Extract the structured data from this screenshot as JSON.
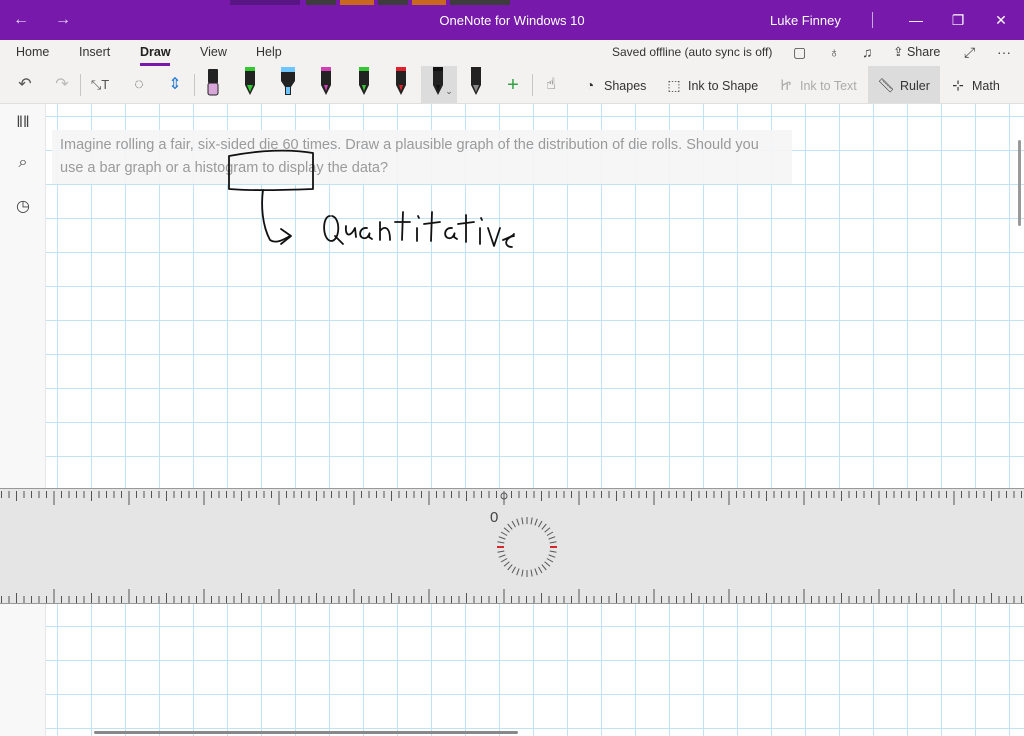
{
  "window": {
    "title": "OneNote for Windows 10",
    "user": "Luke Finney"
  },
  "menu": {
    "items": [
      "Home",
      "Insert",
      "Draw",
      "View",
      "Help"
    ],
    "active": "Draw",
    "sync_status": "Saved offline (auto sync is off)",
    "share_label": "Share"
  },
  "toolbar": {
    "shapes_label": "Shapes",
    "ink_to_shape_label": "Ink to Shape",
    "ink_to_text_label": "Ink to Text",
    "ruler_label": "Ruler",
    "math_label": "Math",
    "pens": [
      {
        "kind": "eraser",
        "color": "#d9a6d9"
      },
      {
        "kind": "pencil",
        "color": "#32c832"
      },
      {
        "kind": "highlighter",
        "color": "#6ec6ff"
      },
      {
        "kind": "pen",
        "color": "#d23fb4"
      },
      {
        "kind": "pen",
        "color": "#32c832"
      },
      {
        "kind": "pen",
        "color": "#e0202a"
      },
      {
        "kind": "pen",
        "color": "#111111",
        "selected": true
      },
      {
        "kind": "pencil",
        "color": "#222222"
      }
    ]
  },
  "page": {
    "question": "Imagine rolling a fair, six-sided die 60 times. Draw a plausible graph of the distribution of die rolls. Should you use a bar graph or a histogram to display the data?",
    "ink_note": "Quantitative"
  },
  "ruler": {
    "zero_label": "0",
    "accent": "#d62828"
  }
}
